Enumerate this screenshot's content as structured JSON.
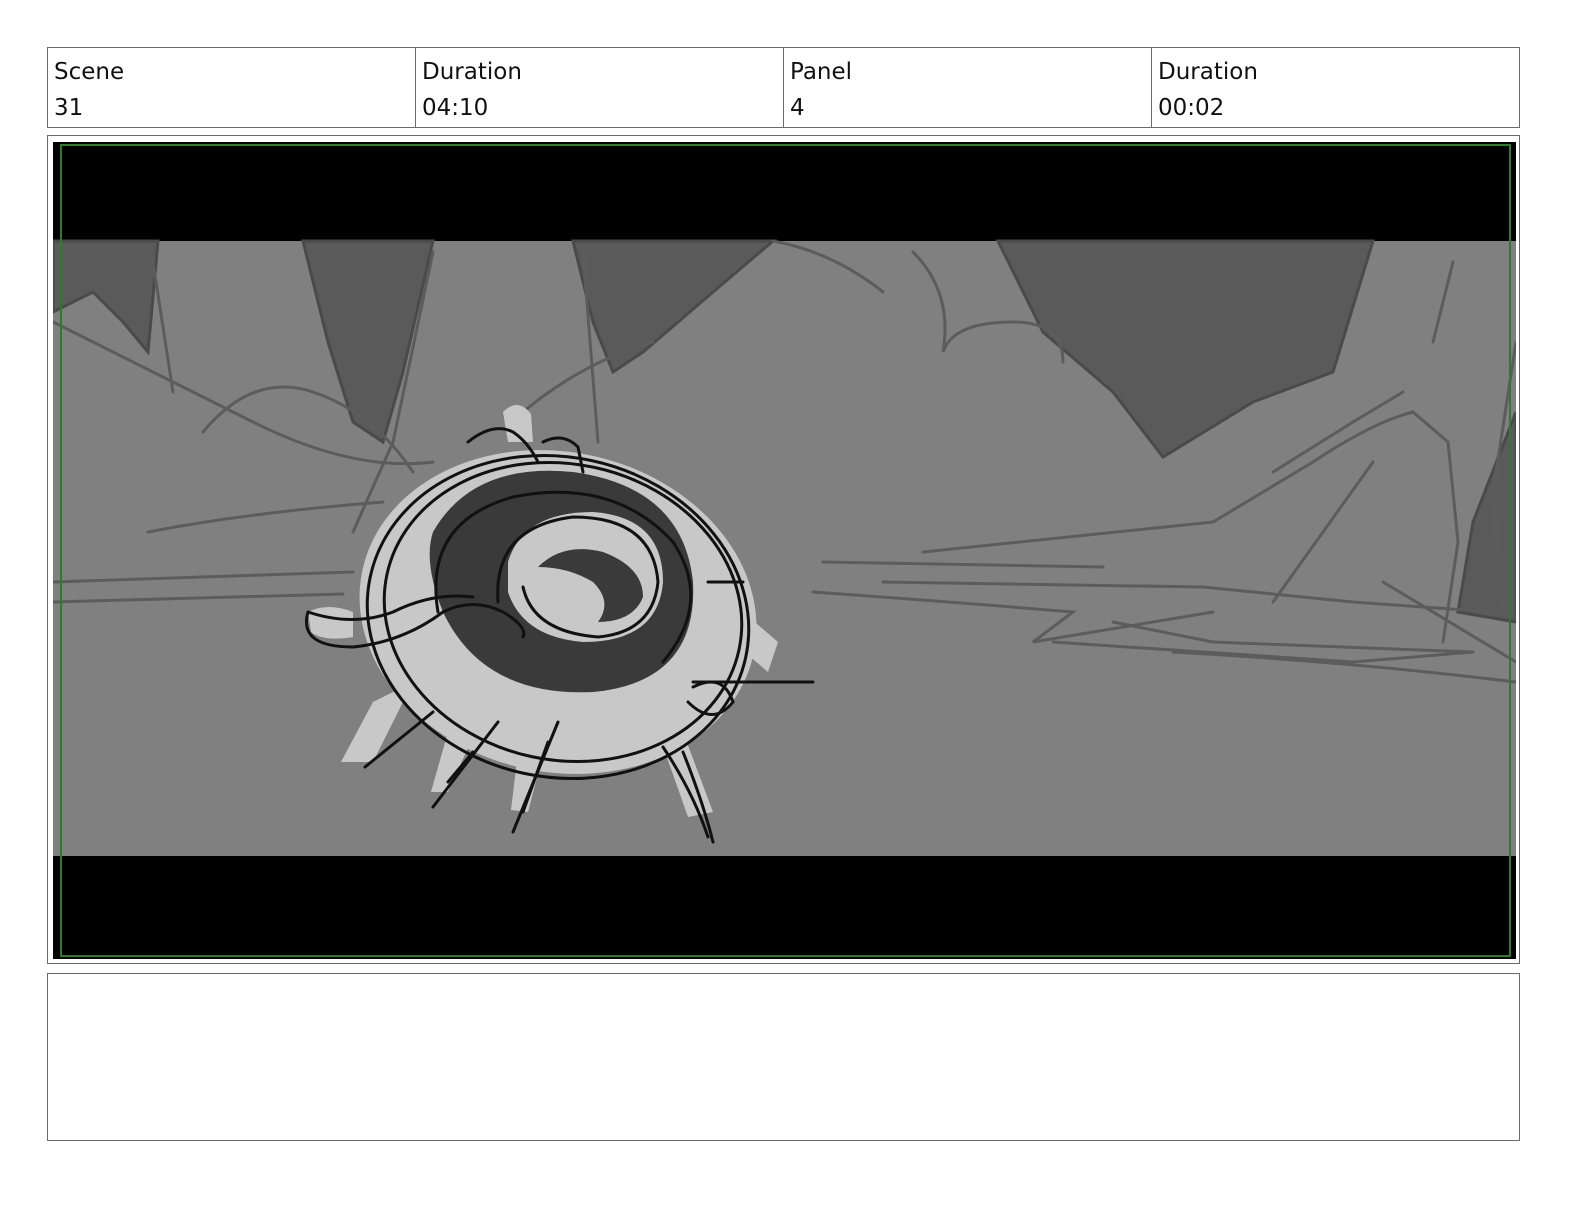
{
  "header": {
    "scene_label": "Scene",
    "scene_value": "31",
    "scene_duration_label": "Duration",
    "scene_duration_value": "04:10",
    "panel_label": "Panel",
    "panel_value": "4",
    "panel_duration_label": "Duration",
    "panel_duration_value": "00:02"
  },
  "notes": {
    "text": ""
  },
  "colors": {
    "border": "#6b6b6b",
    "letterbox": "#000000",
    "safe_frame": "#2f7a2f",
    "sketch_background": "#808080",
    "sketch_dark": "#5a5a5a",
    "sketch_light": "#c8c8c8",
    "sketch_ink": "#111111"
  }
}
